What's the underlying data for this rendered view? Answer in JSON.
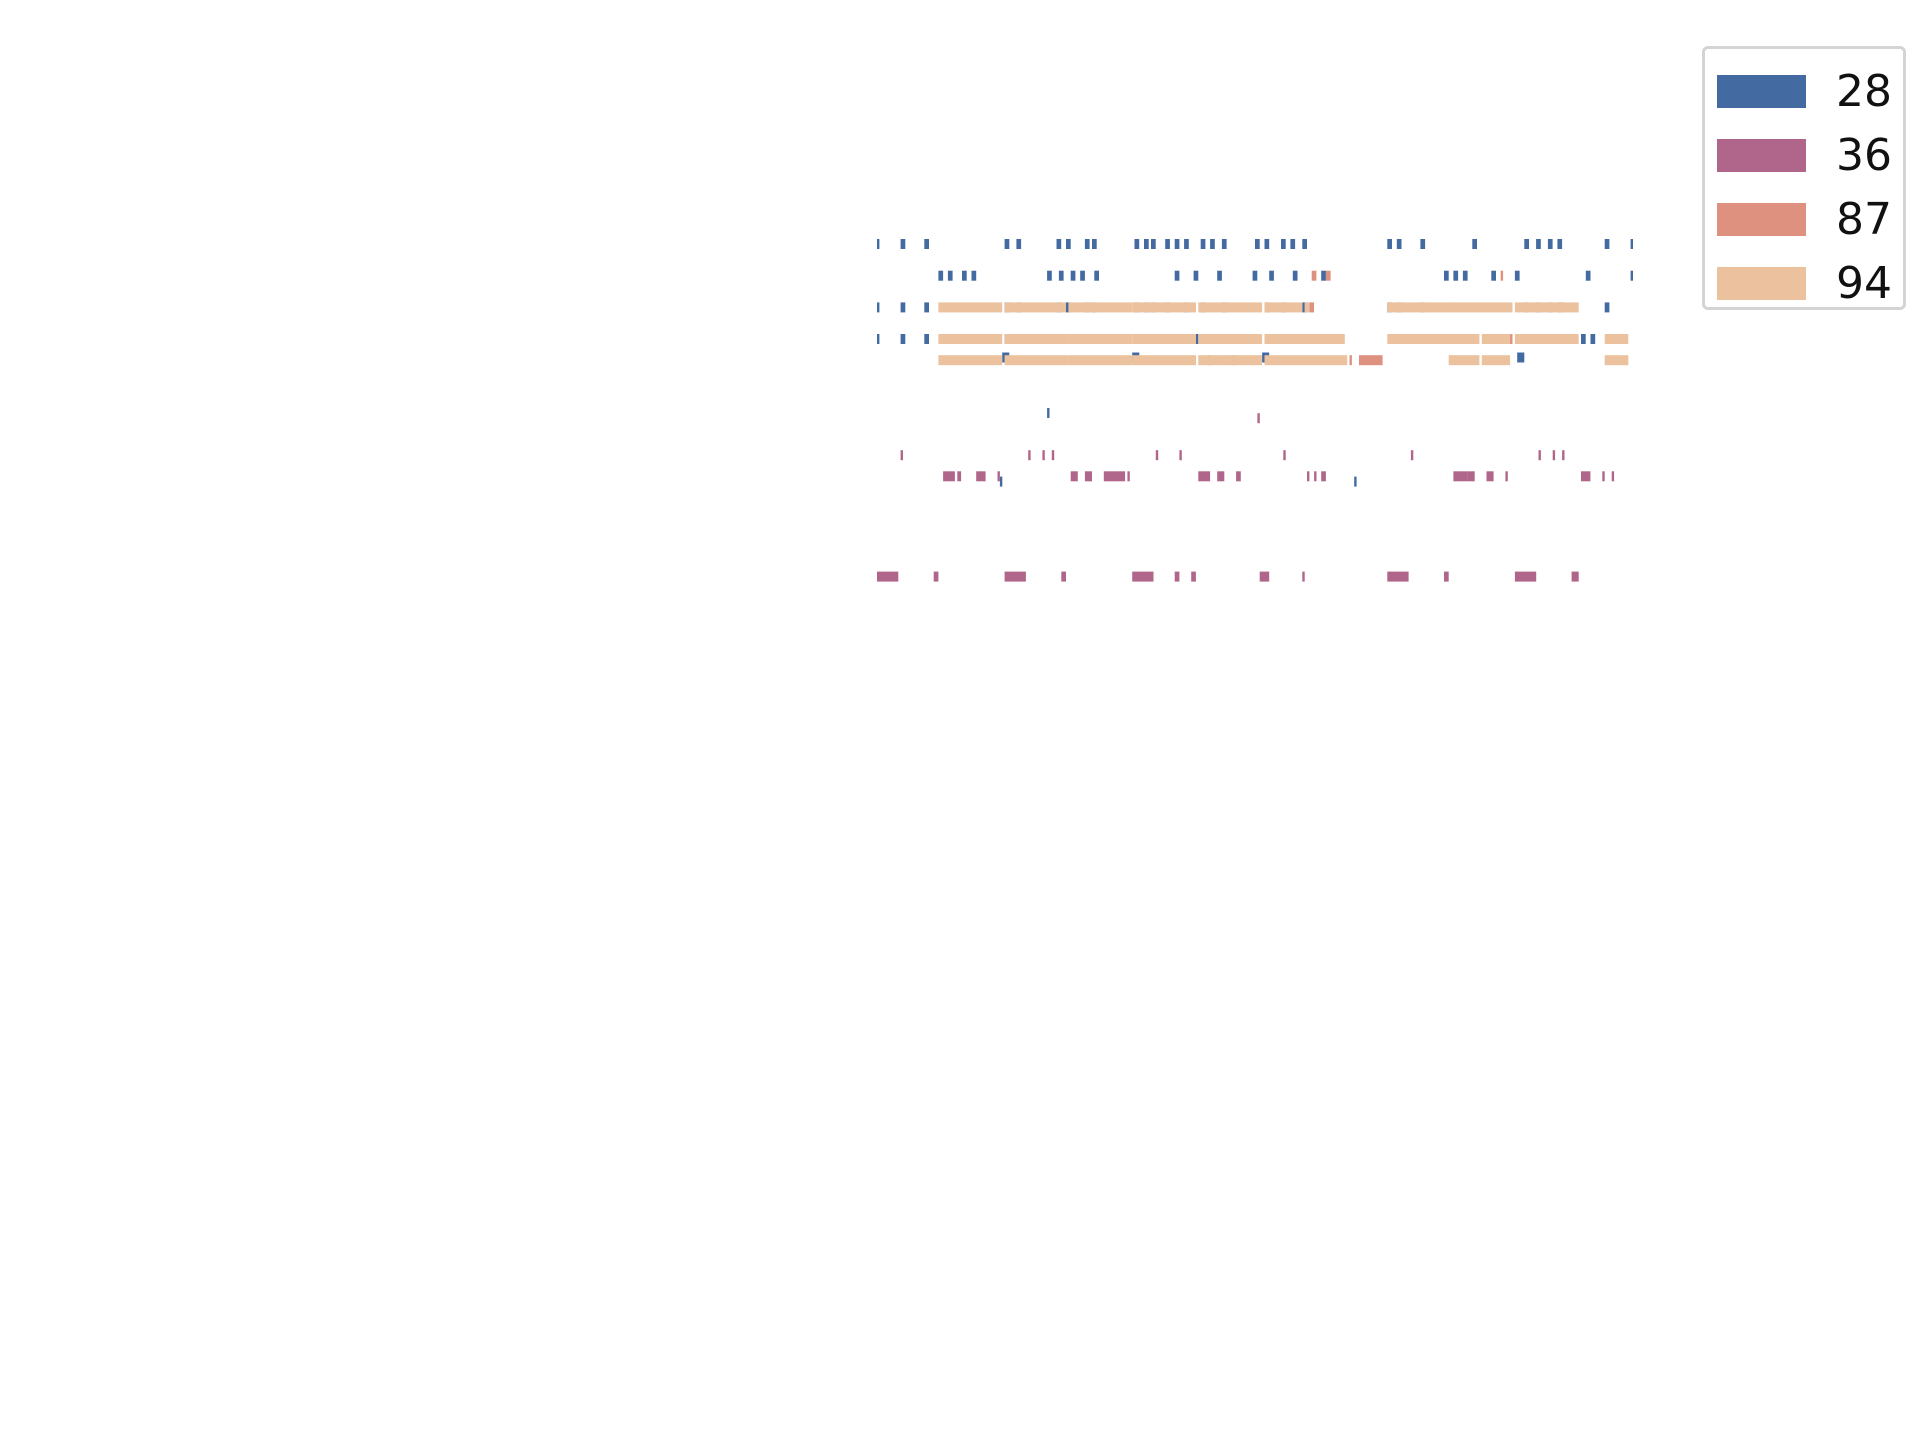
{
  "chart_data": {
    "type": "bar",
    "title": "",
    "xlabel": "",
    "ylabel": "",
    "grid": false,
    "axes": "hidden",
    "legend_placement": "top-right",
    "x_range": [
      0,
      160
    ],
    "row_range": [
      0,
      20
    ],
    "series": [
      {
        "name": "28",
        "color": "#436aa1",
        "events": [
          [
            0,
            17.5,
            0.5
          ],
          [
            5,
            17.5,
            1
          ],
          [
            10,
            17.5,
            1
          ],
          [
            27,
            17.5,
            1
          ],
          [
            29.5,
            17.5,
            1
          ],
          [
            38,
            17.5,
            1
          ],
          [
            40,
            17.5,
            1
          ],
          [
            44,
            17.5,
            1
          ],
          [
            45.5,
            17.5,
            1
          ],
          [
            54.5,
            17.5,
            1
          ],
          [
            56.5,
            17.5,
            1
          ],
          [
            58,
            17.5,
            1
          ],
          [
            61,
            17.5,
            1
          ],
          [
            63,
            17.5,
            1
          ],
          [
            65,
            17.5,
            1
          ],
          [
            68.5,
            17.5,
            1
          ],
          [
            70.5,
            17.5,
            1
          ],
          [
            73,
            17.5,
            1
          ],
          [
            80,
            17.5,
            1
          ],
          [
            82,
            17.5,
            1
          ],
          [
            85.5,
            17.5,
            1
          ],
          [
            87.5,
            17.5,
            1
          ],
          [
            90,
            17.5,
            1
          ],
          [
            108,
            17.5,
            1
          ],
          [
            110,
            17.5,
            1
          ],
          [
            115,
            17.5,
            1
          ],
          [
            126,
            17.5,
            1
          ],
          [
            137,
            17.5,
            1
          ],
          [
            139.5,
            17.5,
            1
          ],
          [
            142,
            17.5,
            1
          ],
          [
            144,
            17.5,
            1
          ],
          [
            154,
            17.5,
            1
          ],
          [
            159.5,
            17.5,
            0.5
          ],
          [
            13,
            16.9,
            1
          ],
          [
            15,
            16.9,
            1
          ],
          [
            18,
            16.9,
            1
          ],
          [
            20,
            16.9,
            1
          ],
          [
            36,
            16.9,
            1
          ],
          [
            38.5,
            16.9,
            1
          ],
          [
            41,
            16.9,
            1
          ],
          [
            43,
            16.9,
            1
          ],
          [
            46,
            16.9,
            1
          ],
          [
            63,
            16.9,
            1
          ],
          [
            67,
            16.9,
            1
          ],
          [
            72,
            16.9,
            1
          ],
          [
            79.5,
            16.9,
            1
          ],
          [
            83,
            16.9,
            1
          ],
          [
            88,
            16.9,
            1
          ],
          [
            94,
            16.9,
            1
          ],
          [
            120,
            16.9,
            1
          ],
          [
            122,
            16.9,
            1
          ],
          [
            124,
            16.9,
            1
          ],
          [
            130,
            16.9,
            1
          ],
          [
            135,
            16.9,
            1
          ],
          [
            150,
            16.9,
            1
          ],
          [
            159.5,
            16.9,
            0.5
          ],
          [
            0,
            16.3,
            0.5
          ],
          [
            5,
            16.3,
            1
          ],
          [
            10,
            16.3,
            1
          ],
          [
            27,
            16.3,
            1
          ],
          [
            29.5,
            16.3,
            1
          ],
          [
            38,
            16.3,
            1
          ],
          [
            40,
            16.3,
            1
          ],
          [
            44,
            16.3,
            1
          ],
          [
            45.5,
            16.3,
            1
          ],
          [
            54.5,
            16.3,
            1
          ],
          [
            56.5,
            16.3,
            1
          ],
          [
            58,
            16.3,
            1
          ],
          [
            61,
            16.3,
            1
          ],
          [
            65,
            16.3,
            1
          ],
          [
            68.5,
            16.3,
            1
          ],
          [
            73,
            16.3,
            1
          ],
          [
            82,
            16.3,
            1
          ],
          [
            85.5,
            16.3,
            1
          ],
          [
            90,
            16.3,
            1
          ],
          [
            108,
            16.3,
            1
          ],
          [
            110,
            16.3,
            1
          ],
          [
            115,
            16.3,
            1
          ],
          [
            137,
            16.3,
            1
          ],
          [
            139.5,
            16.3,
            1
          ],
          [
            142,
            16.3,
            1
          ],
          [
            144,
            16.3,
            1
          ],
          [
            154,
            16.3,
            1
          ],
          [
            0,
            15.7,
            0.5
          ],
          [
            5,
            15.7,
            1
          ],
          [
            10,
            15.7,
            1
          ],
          [
            27,
            15.7,
            2
          ],
          [
            29,
            15.7,
            2
          ],
          [
            31,
            15.7,
            1
          ],
          [
            33,
            15.7,
            1
          ],
          [
            35,
            15.7,
            1
          ],
          [
            38,
            15.7,
            1
          ],
          [
            55,
            15.7,
            2
          ],
          [
            57,
            15.7,
            1
          ],
          [
            59,
            15.7,
            1
          ],
          [
            61,
            15.7,
            1
          ],
          [
            64,
            15.7,
            1
          ],
          [
            67,
            15.7,
            1
          ],
          [
            82,
            15.7,
            1
          ],
          [
            84,
            15.7,
            1
          ],
          [
            86,
            15.7,
            1
          ],
          [
            88,
            15.7,
            1
          ],
          [
            90,
            15.7,
            1
          ],
          [
            142,
            15.7,
            2
          ],
          [
            144,
            15.7,
            1
          ],
          [
            146,
            15.7,
            1
          ],
          [
            149,
            15.7,
            1
          ],
          [
            151,
            15.7,
            1
          ],
          [
            26.5,
            15.35,
            1.5
          ],
          [
            54,
            15.35,
            1.5
          ],
          [
            81.5,
            15.35,
            1.5
          ],
          [
            135.5,
            15.35,
            1.5
          ],
          [
            26,
            13,
            0.5
          ],
          [
            36,
            14.3,
            0.5
          ],
          [
            101,
            13,
            0.5
          ]
        ]
      },
      {
        "name": "36",
        "color": "#b0668a",
        "events": [
          [
            80.5,
            14.2,
            0.5
          ],
          [
            5,
            13.5,
            0.5
          ],
          [
            32,
            13.5,
            0.5
          ],
          [
            35,
            13.5,
            0.5
          ],
          [
            37,
            13.5,
            0.5
          ],
          [
            59,
            13.5,
            0.5
          ],
          [
            64,
            13.5,
            0.5
          ],
          [
            86,
            13.5,
            0.5
          ],
          [
            113,
            13.5,
            0.5
          ],
          [
            140,
            13.5,
            0.5
          ],
          [
            143,
            13.5,
            0.5
          ],
          [
            145,
            13.5,
            0.5
          ],
          [
            14,
            13.1,
            2.5
          ],
          [
            17,
            13.1,
            0.8
          ],
          [
            21,
            13.1,
            2
          ],
          [
            25.5,
            13.1,
            0.5
          ],
          [
            41,
            13.1,
            1.5
          ],
          [
            44,
            13.1,
            1.5
          ],
          [
            48,
            13.1,
            4.5
          ],
          [
            53,
            13.1,
            0.5
          ],
          [
            68,
            13.1,
            2.5
          ],
          [
            72,
            13.1,
            1.5
          ],
          [
            76,
            13.1,
            1
          ],
          [
            91,
            13.1,
            0.5
          ],
          [
            92.5,
            13.1,
            0.5
          ],
          [
            94,
            13.1,
            1
          ],
          [
            122,
            13.1,
            3
          ],
          [
            125,
            13.1,
            1.5
          ],
          [
            129,
            13.1,
            1.5
          ],
          [
            133,
            13.1,
            0.5
          ],
          [
            149,
            13.1,
            2
          ],
          [
            153.5,
            13.1,
            0.5
          ],
          [
            155.5,
            13.1,
            0.5
          ],
          [
            0,
            11.2,
            4.5
          ],
          [
            12,
            11.2,
            1
          ],
          [
            27,
            11.2,
            4.5
          ],
          [
            39,
            11.2,
            1
          ],
          [
            54,
            11.2,
            4.5
          ],
          [
            63,
            11.2,
            1
          ],
          [
            66.5,
            11.2,
            1
          ],
          [
            81,
            11.2,
            2
          ],
          [
            90,
            11.2,
            0.5
          ],
          [
            108,
            11.2,
            4.5
          ],
          [
            120,
            11.2,
            1
          ],
          [
            135,
            11.2,
            4.5
          ],
          [
            147,
            11.2,
            1.5
          ]
        ]
      },
      {
        "name": "87",
        "color": "#de917f",
        "events": [
          [
            92,
            16.9,
            1
          ],
          [
            95,
            16.9,
            1
          ],
          [
            132,
            16.9,
            0.5
          ],
          [
            91.5,
            16.3,
            1
          ],
          [
            144.5,
            16.3,
            1
          ],
          [
            69.5,
            15.7,
            0.5
          ],
          [
            76,
            15.7,
            0.5
          ],
          [
            133.5,
            15.7,
            1
          ],
          [
            70,
            15.3,
            0.5
          ],
          [
            75,
            15.3,
            0.5
          ],
          [
            100,
            15.3,
            0.5
          ],
          [
            102,
            15.3,
            5
          ]
        ]
      },
      {
        "name": "94",
        "color": "#ebc29d",
        "events": [
          [
            13,
            16.3,
            13.5
          ],
          [
            27,
            16.3,
            13
          ],
          [
            40.5,
            16.3,
            13.5
          ],
          [
            54,
            16.3,
            13.5
          ],
          [
            68,
            16.3,
            13.5
          ],
          [
            82,
            16.3,
            8
          ],
          [
            90.5,
            16.3,
            1
          ],
          [
            108,
            16.3,
            13.5
          ],
          [
            121,
            16.3,
            13.5
          ],
          [
            135,
            16.3,
            13.5
          ],
          [
            13,
            15.7,
            13.5
          ],
          [
            27,
            15.7,
            13.5
          ],
          [
            40.5,
            15.7,
            13.5
          ],
          [
            54,
            15.7,
            13.5
          ],
          [
            68,
            15.7,
            13.5
          ],
          [
            82,
            15.7,
            17
          ],
          [
            108,
            15.7,
            13.5
          ],
          [
            121,
            15.7,
            6.5
          ],
          [
            128,
            15.7,
            6
          ],
          [
            135,
            15.7,
            13.5
          ],
          [
            154,
            15.7,
            5
          ],
          [
            13,
            15.3,
            13.5
          ],
          [
            27,
            15.3,
            13.5
          ],
          [
            40.5,
            15.3,
            13.5
          ],
          [
            54,
            15.3,
            13.5
          ],
          [
            68,
            15.3,
            13.5
          ],
          [
            82,
            15.3,
            17.5
          ],
          [
            121,
            15.3,
            6.5
          ],
          [
            128,
            15.3,
            6
          ],
          [
            154,
            15.3,
            5
          ]
        ]
      }
    ]
  }
}
